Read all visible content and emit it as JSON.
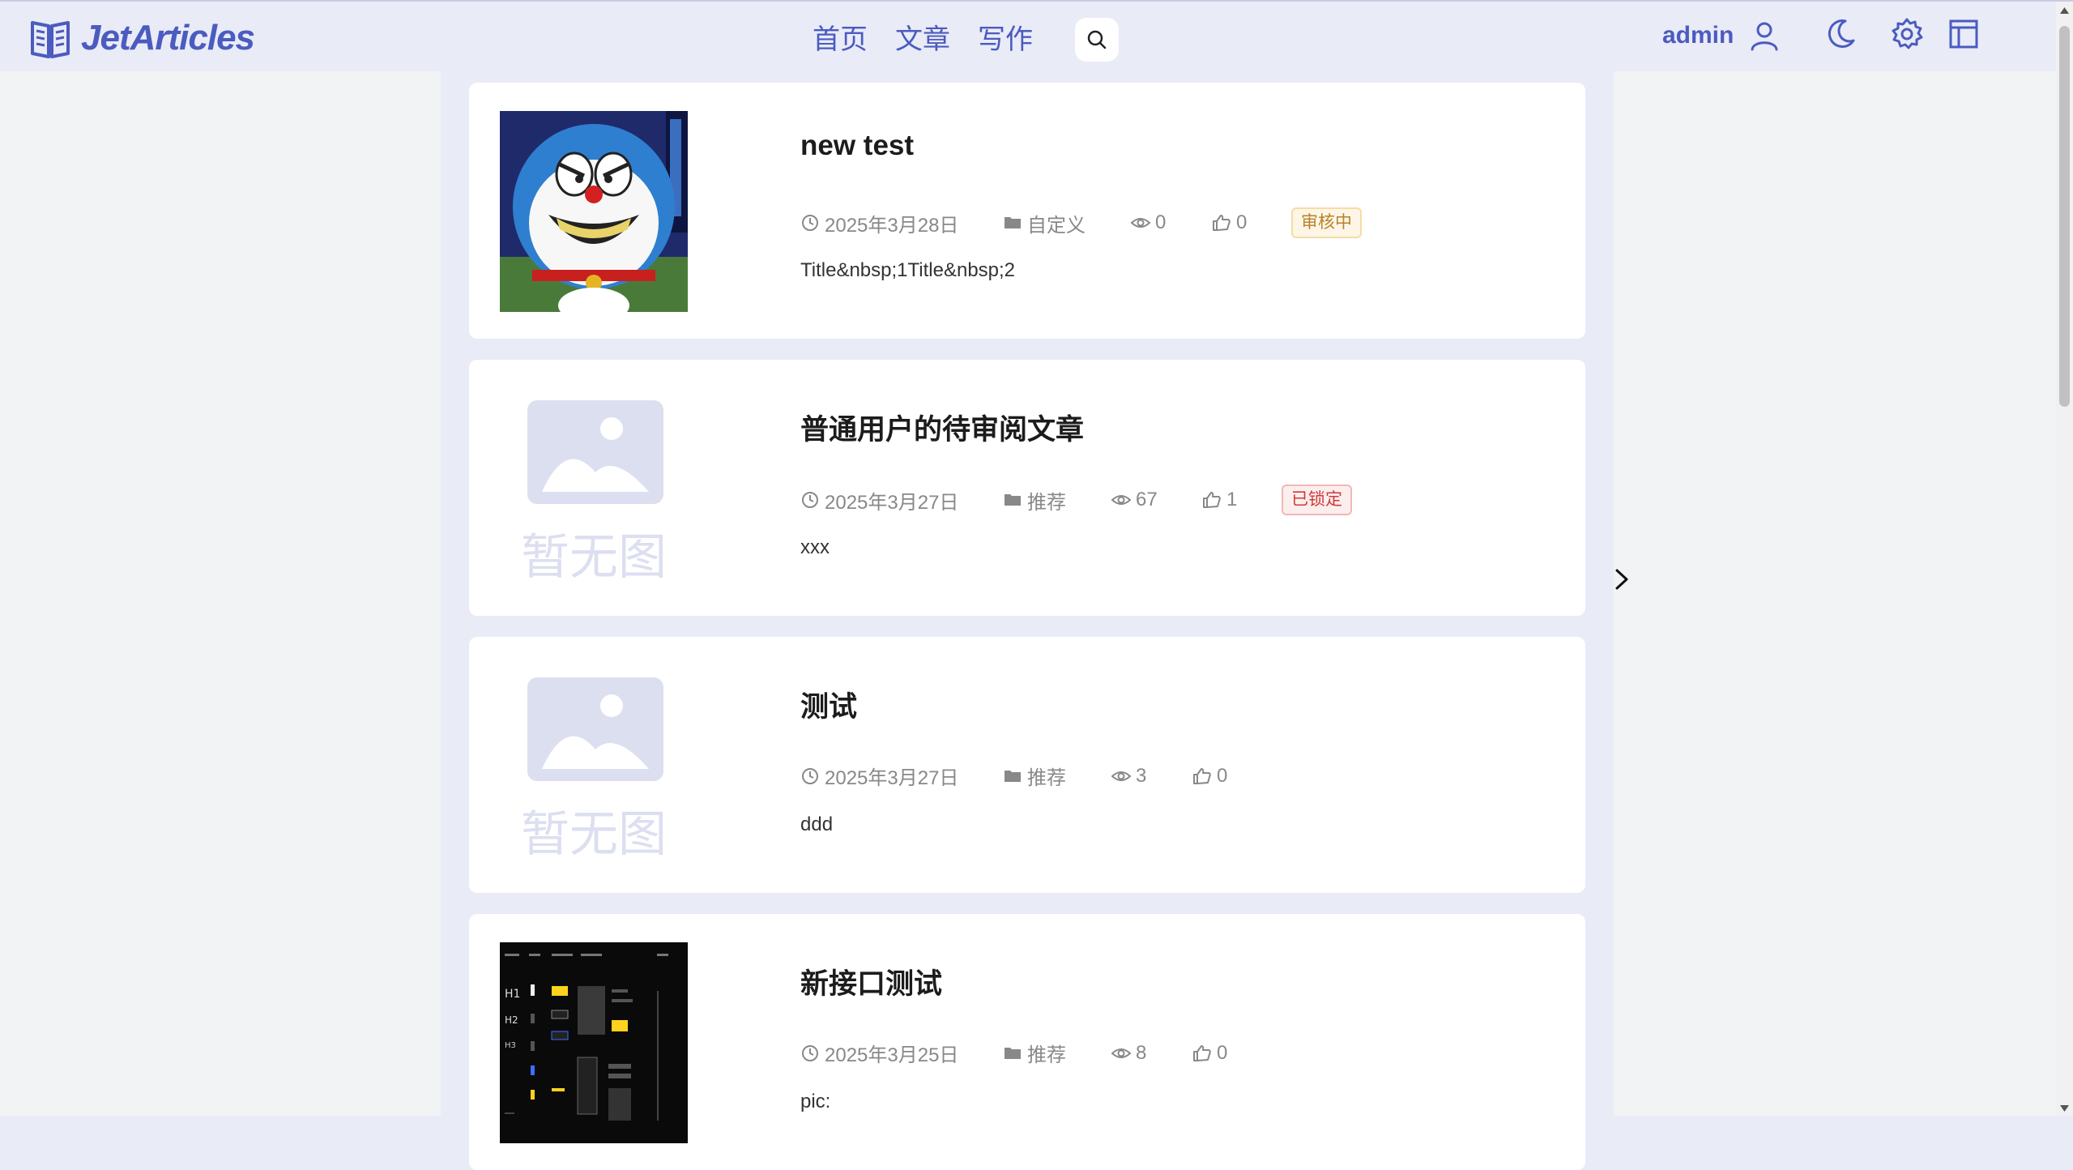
{
  "header": {
    "logo_text": "JetArticles",
    "nav": [
      "首页",
      "文章",
      "写作"
    ],
    "user_name": "admin"
  },
  "articles": [
    {
      "title": "new test",
      "date": "2025年3月28日",
      "category": "自定义",
      "views": "0",
      "likes": "0",
      "badge": "审核中",
      "summary": "Title&nbsp;1Title&nbsp;2",
      "image": "doraemon"
    },
    {
      "title": "普通用户的待审阅文章",
      "date": "2025年3月27日",
      "category": "推荐",
      "views": "67",
      "likes": "1",
      "badge": "已锁定",
      "summary": "xxx",
      "image": "none",
      "noimg_text": "暂无图片"
    },
    {
      "title": "测试",
      "date": "2025年3月27日",
      "category": "推荐",
      "views": "3",
      "likes": "0",
      "summary": "ddd",
      "image": "none",
      "noimg_text": "暂无图片"
    },
    {
      "title": "新接口测试",
      "date": "2025年3月25日",
      "category": "推荐",
      "views": "8",
      "likes": "0",
      "summary": "pic:",
      "image": "dark-screenshot"
    }
  ],
  "colors": {
    "accent": "#4b5bbf",
    "background": "#e9ebf7",
    "badge_review": "#b8822a",
    "badge_locked": "#cf3a3a"
  },
  "icons": [
    "book-logo-icon",
    "search-icon",
    "user-icon",
    "moon-icon",
    "gear-icon",
    "layout-icon",
    "clock-icon",
    "folder-icon",
    "eye-icon",
    "thumbs-up-icon",
    "chevron-right-icon"
  ]
}
